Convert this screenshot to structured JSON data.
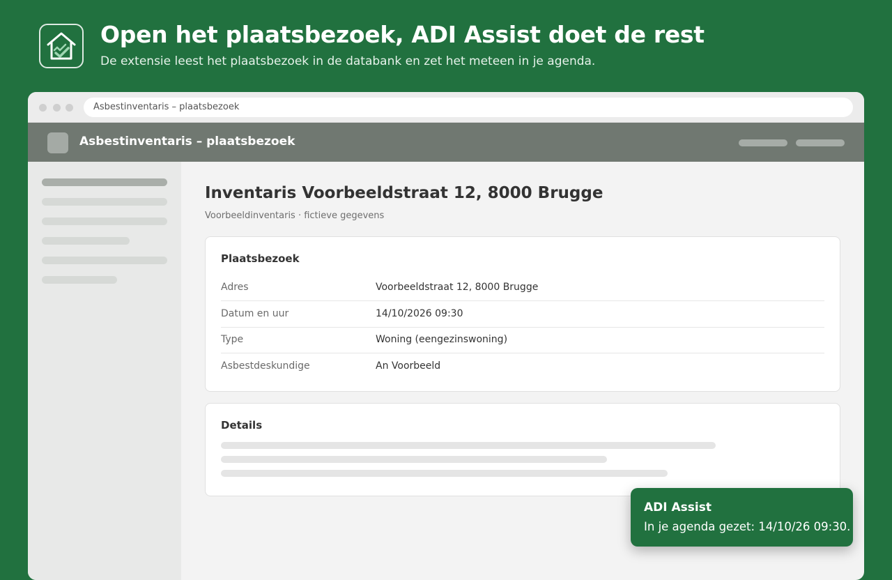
{
  "hero": {
    "title": "Open het plaatsbezoek, ADI Assist doet de rest",
    "subtitle": "De extensie leest het plaatsbezoek in de databank en zet het meteen in je agenda.",
    "logo_icon": "house-check-icon"
  },
  "browser": {
    "url": "Asbestinventaris – plaatsbezoek"
  },
  "app": {
    "title": "Asbestinventaris – plaatsbezoek"
  },
  "page": {
    "title": "Inventaris Voorbeeldstraat 12, 8000 Brugge",
    "subtitle": "Voorbeeldinventaris · fictieve gegevens"
  },
  "visit_card": {
    "title": "Plaatsbezoek",
    "rows": [
      {
        "label": "Adres",
        "value": "Voorbeeldstraat 12, 8000 Brugge"
      },
      {
        "label": "Datum en uur",
        "value": "14/10/2026 09:30"
      },
      {
        "label": "Type",
        "value": "Woning (eengezinswoning)"
      },
      {
        "label": "Asbestdeskundige",
        "value": "An Voorbeeld"
      }
    ]
  },
  "details_card": {
    "title": "Details"
  },
  "toast": {
    "title": "ADI Assist",
    "message": "In je agenda gezet: 14/10/26 09:30."
  },
  "colors": {
    "brand_green": "#21713f",
    "appbar_gray": "#707871"
  }
}
